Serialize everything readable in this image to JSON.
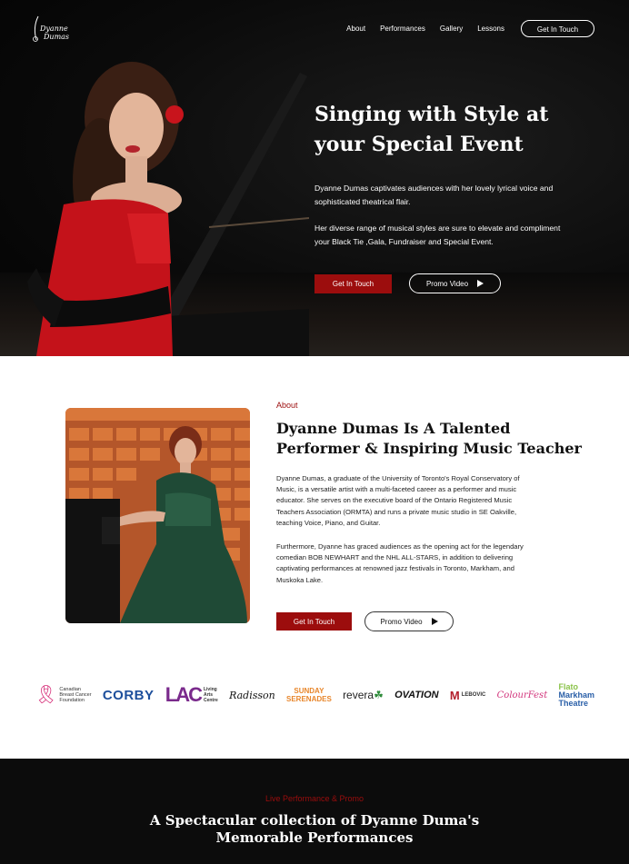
{
  "brand": {
    "logo_line1": "Dyanne",
    "logo_line2": "Dumas"
  },
  "nav": {
    "items": [
      "About",
      "Performances",
      "Gallery",
      "Lessons"
    ],
    "cta": "Get In Touch"
  },
  "hero": {
    "title_line1": "Singing with Style at",
    "title_line2": "your Special Event",
    "paragraph1": "Dyanne Dumas captivates audiences with her lovely lyrical voice and sophisticated theatrical flair.",
    "paragraph2": "Her diverse range of musical styles are sure to elevate and compliment your Black Tie ,Gala, Fundraiser and Special Event.",
    "cta_primary": "Get In Touch",
    "cta_secondary": "Promo Video"
  },
  "about": {
    "eyebrow": "About",
    "title": "Dyanne Dumas Is A Talented Performer & Inspiring Music Teacher",
    "paragraph1": "Dyanne Dumas, a graduate of the University of Toronto's Royal Conservatory of Music, is a versatile artist with a multi-faceted career as a performer and music educator. She serves on the executive board of the Ontario Registered Music Teachers Association (ORMTA) and runs a private music studio in SE Oakville, teaching Voice, Piano, and Guitar.",
    "paragraph2": "Furthermore, Dyanne has graced audiences as the opening act for the legendary comedian BOB NEWHART and the NHL ALL-STARS, in addition to delivering captivating performances at renowned jazz festivals in Toronto, Markham, and Muskoka Lake.",
    "cta_primary": "Get In Touch",
    "cta_secondary": "Promo Video"
  },
  "partners": {
    "cbcf": [
      "Canadian",
      "Breast Cancer",
      "Foundation"
    ],
    "corby": "CORBY",
    "lac": {
      "mark": "LAC",
      "text": [
        "Living",
        "Arts",
        "Centre"
      ]
    },
    "radisson": "Radisson",
    "sunday": [
      "SUNDAY",
      "SERENADES"
    ],
    "revera": "revera",
    "ovation": "OVATION",
    "lebovic": {
      "mark": "M",
      "text": "LEBOVIC"
    },
    "colourfest": "ColourFest",
    "markham": [
      "Flato",
      "Markham",
      "Theatre"
    ]
  },
  "performances": {
    "eyebrow": "Live Performance & Promo",
    "title_line1": "A Spectacular collection of Dyanne Duma's",
    "title_line2": "Memorable Performances"
  }
}
